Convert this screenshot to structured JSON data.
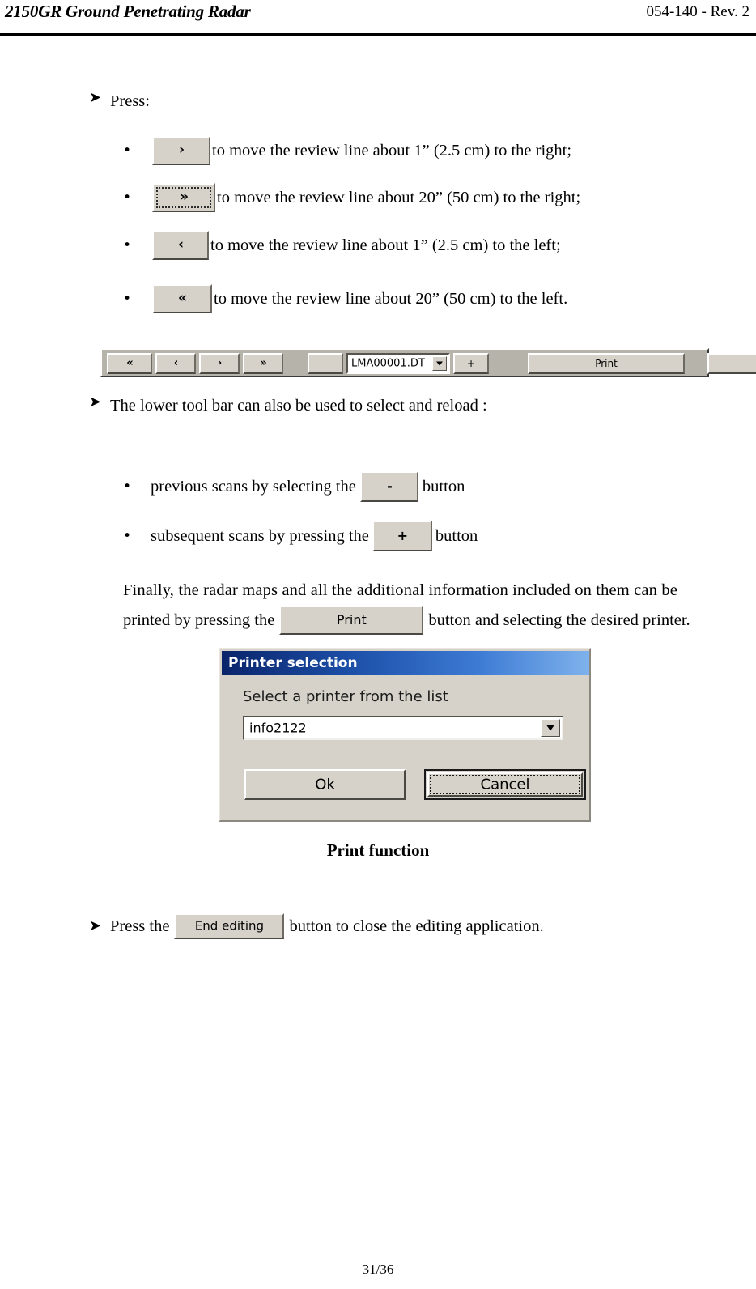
{
  "header": {
    "left_title": "2150GR Ground Penetrating Radar",
    "right_ref": "054-140 - Rev. 2"
  },
  "footer": {
    "page_number": "31/36"
  },
  "icons": {
    "arrow_bullet": "➤",
    "dot_bullet": "•",
    "chevron_right": "›",
    "chevron_double_right": "»",
    "chevron_left": "‹",
    "chevron_double_left": "«",
    "dropdown_arrow": "▼"
  },
  "section_press": {
    "heading": "Press:",
    "items": [
      {
        "button_glyph": "›",
        "button_name": "step-right-button",
        "focused": false,
        "text": " to move the review line about  1” (2.5 cm) to the right;"
      },
      {
        "button_glyph": "»",
        "button_name": "jump-right-button",
        "focused": true,
        "text": " to move the review line about 20” (50 cm) to the right;"
      },
      {
        "button_glyph": "‹",
        "button_name": "step-left-button",
        "focused": false,
        "text": " to move the review line about 1” (2.5 cm) to the left;"
      },
      {
        "button_glyph": "«",
        "button_name": "jump-left-button",
        "focused": false,
        "text": " to move the review line about 20” (50 cm) to the left."
      }
    ]
  },
  "toolbar": {
    "buttons": {
      "jump_left": "«",
      "step_left": "‹",
      "step_right": "›",
      "jump_right": "»",
      "minus": "-",
      "plus": "+",
      "print": "Print",
      "end_editing": "End editing"
    },
    "file_combo": {
      "value": "LMA00001.DT"
    }
  },
  "section_toolbar": {
    "heading": "The lower tool bar can also be used to select and reload :",
    "items": [
      {
        "text_before": "previous scans by selecting the",
        "button_glyph": "-",
        "button_name": "previous-scan-button",
        "text_after": "button"
      },
      {
        "text_before": "subsequent scans by pressing the",
        "button_glyph": "+",
        "button_name": "next-scan-button",
        "text_after": "button"
      }
    ]
  },
  "paragraph_print": {
    "line1": "Finally, the radar maps and all the additional information included on them can be",
    "line2_before": "printed by pressing the",
    "line2_button": "Print",
    "line2_after": "button and selecting the desired printer."
  },
  "printer_dialog": {
    "title": "Printer selection",
    "label": "Select a printer from the list",
    "selected_printer": "info2122",
    "ok_label": "Ok",
    "cancel_label": "Cancel"
  },
  "figure_caption": "Print function",
  "section_end": {
    "text_before": "Press the",
    "button_label": "End editing",
    "text_after": "button to close the editing application."
  },
  "colors": {
    "button_face": "#d6d2ca",
    "toolbar_face": "#b6b3ab",
    "titlebar_dark": "#0a246a",
    "titlebar_light": "#7fb2ec",
    "rule": "#000000"
  }
}
